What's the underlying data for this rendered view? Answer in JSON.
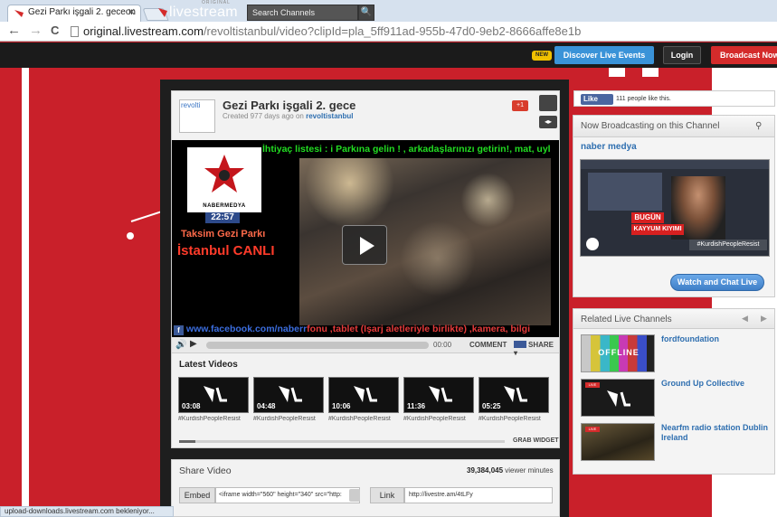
{
  "browser": {
    "tab_title": "Gezi Parkı işgali 2. geceon",
    "tab_close": "✕",
    "back": "←",
    "forward": "→",
    "reload": "C",
    "url_host": "original.livestream.com",
    "url_path": "/revoltistanbul/video?clipId=pla_5ff911ad-955b-47d0-9eb2-8666affe8e1b",
    "status_text": "upload-downloads.livestream.com bekleniyor..."
  },
  "header": {
    "logo_text": "livestream",
    "logo_sup": "ORIGINAL",
    "search_placeholder": "Search Channels",
    "search_icon_glyph": "🔍",
    "new_badge": "NEW",
    "discover_label": "Discover Live Events",
    "login_label": "Login",
    "broadcast_label": "Broadcast Now"
  },
  "video": {
    "channel_thumb_alt": "revolti",
    "title": "Gezi Parkı işgali 2. gece",
    "meta_prefix": "Created 977 days ago on ",
    "meta_channel": "revoltistanbul",
    "gplus_label": "+1",
    "embed_icon_glyph": "◂▸",
    "ticker_top": "İhtiyaç listesi : i Parkına gelin ! , arkadaşlarınızı getirin!, mat, uyl",
    "overlay_logo_text": "NABERMEDYA",
    "overlay_time": "22:57",
    "overlay_taksim": "Taksim Gezi Parkı",
    "overlay_istanbul": "İstanbul CANLI",
    "ticker_bottom_fb": "www.facebook.com/naberr",
    "ticker_bottom_red": "fonu ,tablet (Işarj aletleriyle birlikte) ,kamera, bilgi",
    "volume_glyph": "🔊",
    "play_glyph": "▶",
    "time": "00:00",
    "comment_label": "COMMENT",
    "share_label": "SHARE ▾"
  },
  "latest": {
    "title": "Latest Videos",
    "items": [
      {
        "duration": "03:08",
        "caption": "#KurdishPeopleResist"
      },
      {
        "duration": "04:48",
        "caption": "#KurdishPeopleResist"
      },
      {
        "duration": "10:06",
        "caption": "#KurdishPeopleResist"
      },
      {
        "duration": "11:36",
        "caption": "#KurdishPeopleResist"
      },
      {
        "duration": "05:25",
        "caption": "#KurdishPeopleResist"
      }
    ],
    "grab_widget": "GRAB WIDGET"
  },
  "share": {
    "title": "Share Video",
    "viewers_count": "39,384,045",
    "viewers_unit": " viewer minutes",
    "embed_label": "Embed",
    "embed_value": "<iframe width=\"560\" height=\"340\" src=\"http:",
    "link_label": "Link",
    "link_value": "http://livestre.am/4tLFy"
  },
  "facebook": {
    "like_label": "Like",
    "like_text": "111 people like this."
  },
  "now": {
    "title": "Now Broadcasting on this Channel",
    "person_glyph": "⚲",
    "channel_name": "naber medya",
    "thumb_bugun": "BUGÜN",
    "thumb_kayyum": "KAYYUM KIYIMI",
    "thumb_hashtag": "#KurdishPeopleResist",
    "watch_label": "Watch and Chat Live"
  },
  "related": {
    "title": "Related Live Channels",
    "prev_glyph": "◀",
    "next_glyph": "▶",
    "offline_label": "OFFLINE",
    "live_tag": "LIVE",
    "items": [
      {
        "name": "fordfoundation"
      },
      {
        "name": "Ground Up Collective"
      },
      {
        "name": "Nearfm radio station Dublin Ireland"
      }
    ]
  },
  "colors": {
    "brand_red": "#c9202a",
    "discover_blue": "#3a93d8",
    "link_blue": "#2f6fb0"
  }
}
